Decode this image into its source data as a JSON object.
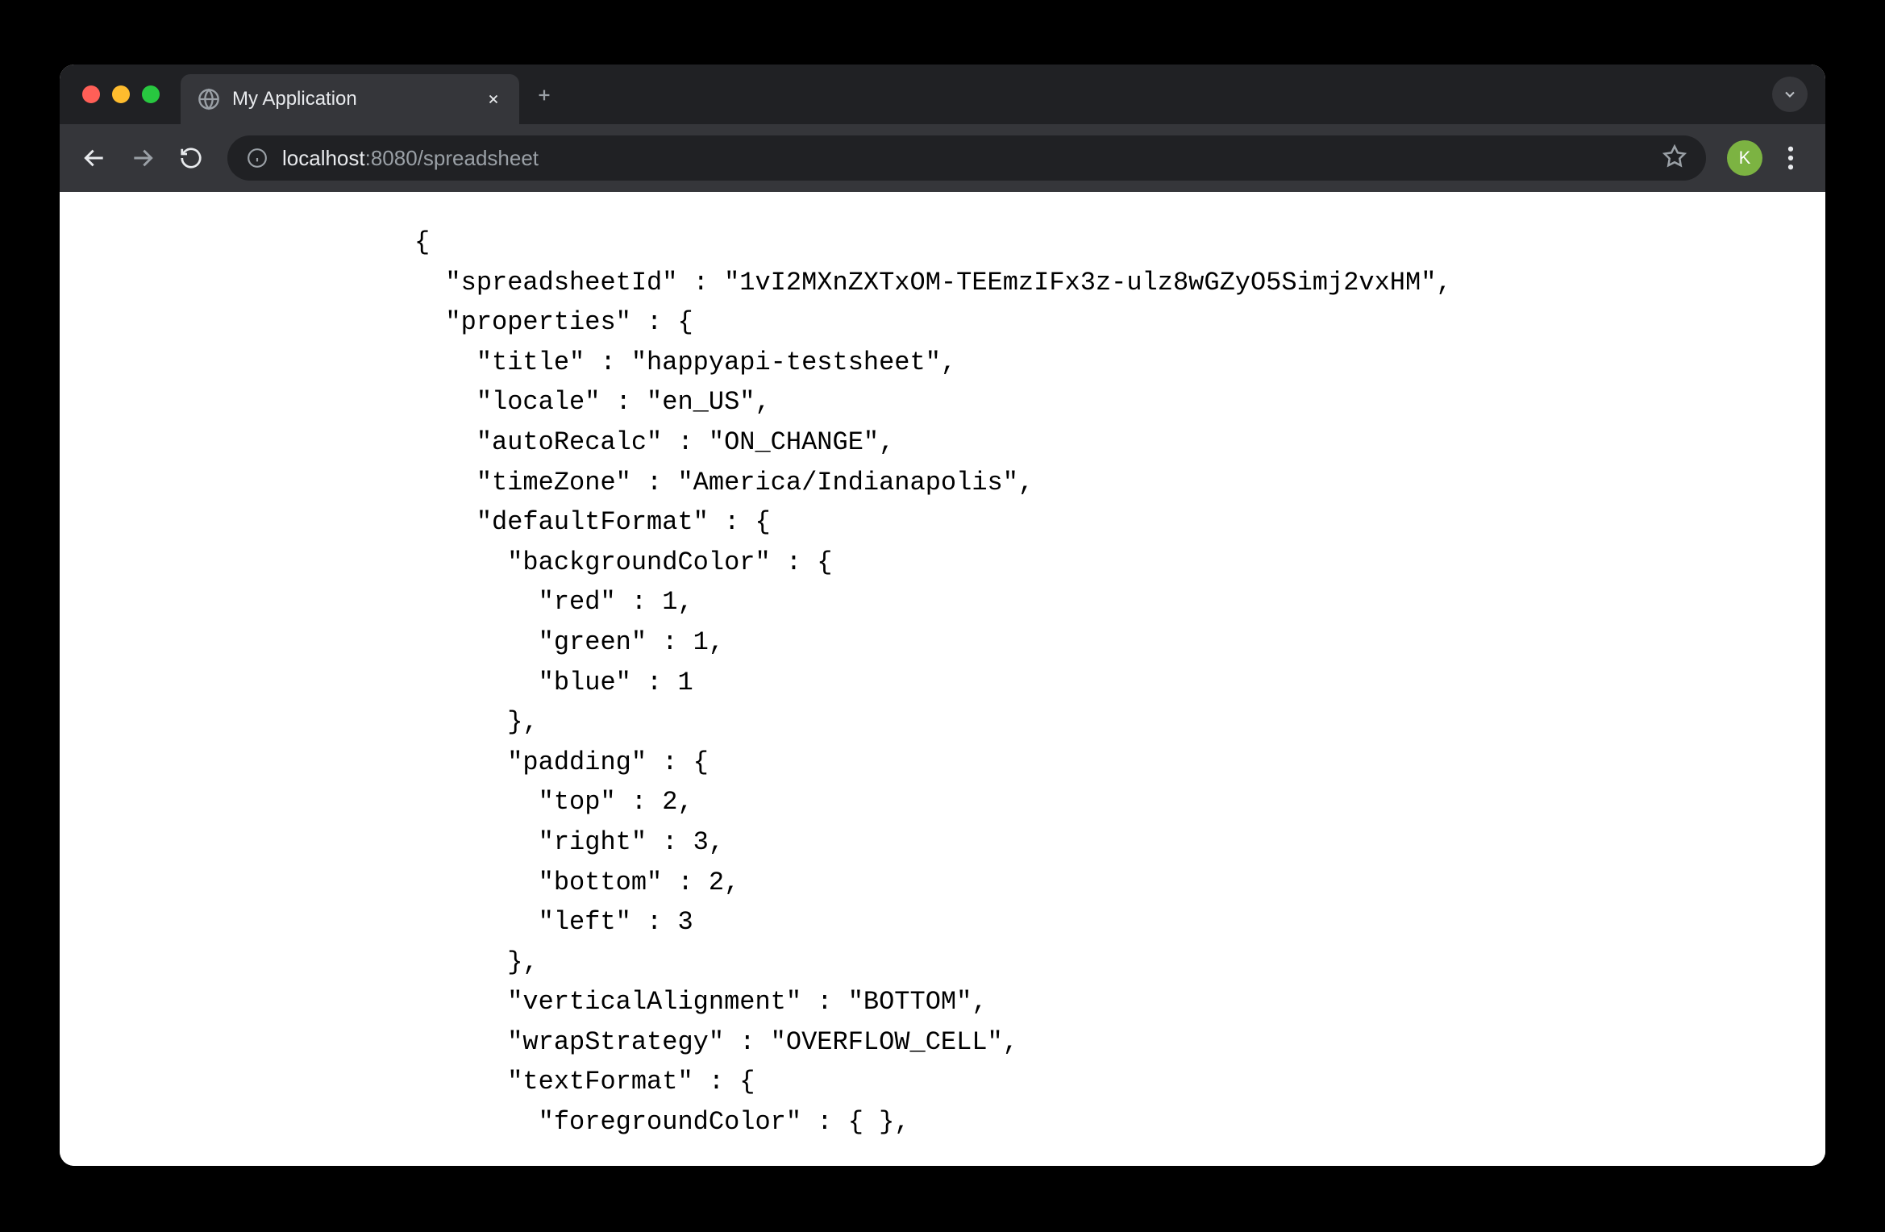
{
  "browser": {
    "tab_title": "My Application",
    "url_prefix": "localhost",
    "url_port_path": ":8080/spreadsheet",
    "profile_letter": "K"
  },
  "json_lines": [
    "{",
    "  \"spreadsheetId\" : \"1vI2MXnZXTxOM-TEEmzIFx3z-ulz8wGZyO5Simj2vxHM\",",
    "  \"properties\" : {",
    "    \"title\" : \"happyapi-testsheet\",",
    "    \"locale\" : \"en_US\",",
    "    \"autoRecalc\" : \"ON_CHANGE\",",
    "    \"timeZone\" : \"America/Indianapolis\",",
    "    \"defaultFormat\" : {",
    "      \"backgroundColor\" : {",
    "        \"red\" : 1,",
    "        \"green\" : 1,",
    "        \"blue\" : 1",
    "      },",
    "      \"padding\" : {",
    "        \"top\" : 2,",
    "        \"right\" : 3,",
    "        \"bottom\" : 2,",
    "        \"left\" : 3",
    "      },",
    "      \"verticalAlignment\" : \"BOTTOM\",",
    "      \"wrapStrategy\" : \"OVERFLOW_CELL\",",
    "      \"textFormat\" : {",
    "        \"foregroundColor\" : { },"
  ]
}
